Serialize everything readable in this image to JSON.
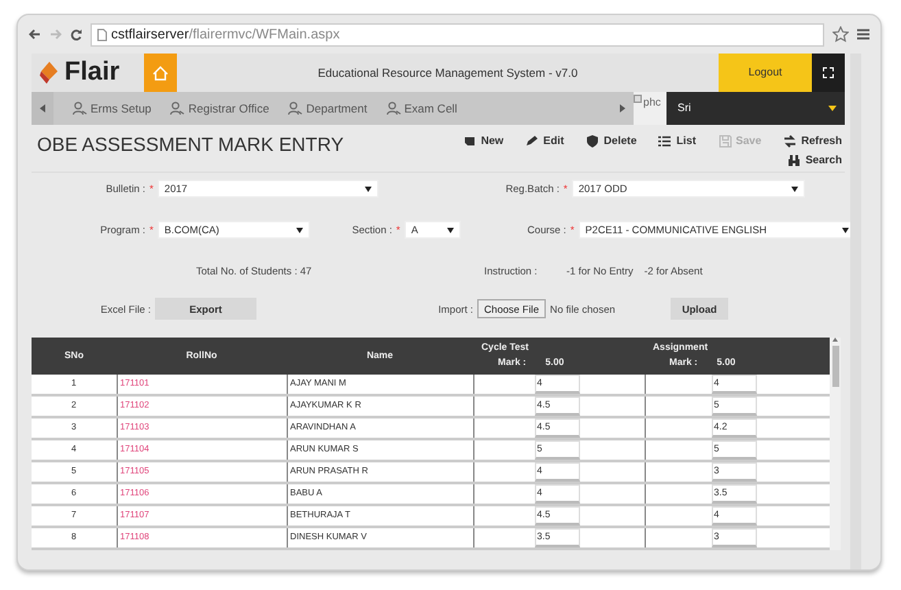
{
  "browser": {
    "url_host": "cstflairserver",
    "url_path": "/flairermvc/WFMain.aspx"
  },
  "header": {
    "logo": "Flair",
    "title": "Educational Resource Management System - v7.0",
    "logout": "Logout"
  },
  "nav": {
    "items": [
      {
        "label": "Erms Setup"
      },
      {
        "label": "Registrar Office"
      },
      {
        "label": "Department"
      },
      {
        "label": "Exam Cell"
      }
    ],
    "broken_image_text": "phc",
    "user": "Sri"
  },
  "page": {
    "title": "OBE ASSESSMENT MARK ENTRY",
    "actions": [
      {
        "kind": "new",
        "label": "New",
        "disabled": false
      },
      {
        "kind": "edit",
        "label": "Edit",
        "disabled": false
      },
      {
        "kind": "delete",
        "label": "Delete",
        "disabled": false
      },
      {
        "kind": "list",
        "label": "List",
        "disabled": false
      },
      {
        "kind": "save",
        "label": "Save",
        "disabled": true
      },
      {
        "kind": "refresh",
        "label": "Refresh",
        "disabled": false
      },
      {
        "kind": "search",
        "label": "Search",
        "disabled": false
      }
    ]
  },
  "form": {
    "bulletin": {
      "label": "Bulletin :",
      "required_mark": "*",
      "value": "2017"
    },
    "reg_batch": {
      "label": "Reg.Batch :",
      "required_mark": "*",
      "value": "2017 ODD"
    },
    "program": {
      "label": "Program :",
      "required_mark": "*",
      "value": "B.COM(CA)"
    },
    "section": {
      "label": "Section :",
      "required_mark": "*",
      "value": "A"
    },
    "course": {
      "label": "Course :",
      "required_mark": "*",
      "value": "P2CE11 - COMMUNICATIVE ENGLISH"
    }
  },
  "info": {
    "total": "Total No. of Students : 47",
    "instruction_label": "Instruction :",
    "instructions": [
      "-1 for No Entry",
      "-2 for Absent"
    ]
  },
  "excel": {
    "label": "Excel File :",
    "export": "Export",
    "import_label": "Import :",
    "choose": "Choose File",
    "file_status": "No file chosen",
    "upload": "Upload"
  },
  "table": {
    "columns": [
      {
        "label": "SNo"
      },
      {
        "label": "RollNo"
      },
      {
        "label": "Name"
      },
      {
        "label": "Cycle Test",
        "mark_label": "Mark :",
        "mark": "5.00"
      },
      {
        "label": "Assignment",
        "mark_label": "Mark :",
        "mark": "5.00"
      }
    ],
    "rows": [
      {
        "sno": "1",
        "roll_no": "171101",
        "name": "AJAY MANI M",
        "cycle_test": "4",
        "assignment": "4"
      },
      {
        "sno": "2",
        "roll_no": "171102",
        "name": "AJAYKUMAR K R",
        "cycle_test": "4.5",
        "assignment": "5"
      },
      {
        "sno": "3",
        "roll_no": "171103",
        "name": "ARAVINDHAN A",
        "cycle_test": "4.5",
        "assignment": "4.2"
      },
      {
        "sno": "4",
        "roll_no": "171104",
        "name": "ARUN KUMAR S",
        "cycle_test": "5",
        "assignment": "5"
      },
      {
        "sno": "5",
        "roll_no": "171105",
        "name": "ARUN PRASATH R",
        "cycle_test": "4",
        "assignment": "3"
      },
      {
        "sno": "6",
        "roll_no": "171106",
        "name": "BABU A",
        "cycle_test": "4",
        "assignment": "3.5"
      },
      {
        "sno": "7",
        "roll_no": "171107",
        "name": "BETHURAJA T",
        "cycle_test": "4.5",
        "assignment": "4"
      },
      {
        "sno": "8",
        "roll_no": "171108",
        "name": "DINESH KUMAR V",
        "cycle_test": "3.5",
        "assignment": "3"
      }
    ]
  }
}
